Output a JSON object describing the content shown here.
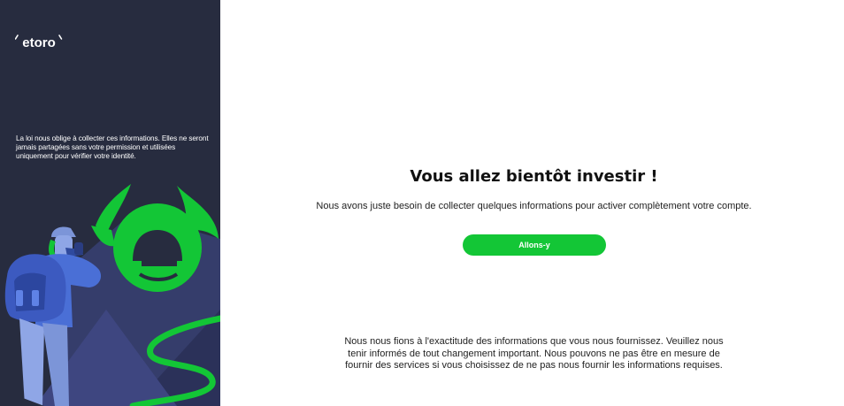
{
  "brand": {
    "logo_text": "etoro",
    "accent_color": "#13c636",
    "sidebar_color": "#272c3f"
  },
  "sidebar": {
    "legal_note": "La loi nous oblige à collecter ces informations. Elles ne seront jamais partagées sans votre permission et utilisées uniquement pour vérifier votre identité."
  },
  "main": {
    "title": "Vous allez bientôt investir !",
    "subtitle": "Nous avons juste besoin de collecter quelques informations pour activer complètement votre compte.",
    "cta_label": "Allons-y",
    "disclaimer": "Nous nous fions à l'exactitude des informations que vous nous fournissez. Veuillez nous tenir informés de tout changement important. Nous pouvons ne pas être en mesure de fournir des services si vous choisissez de ne pas nous fournir les informations requises."
  }
}
